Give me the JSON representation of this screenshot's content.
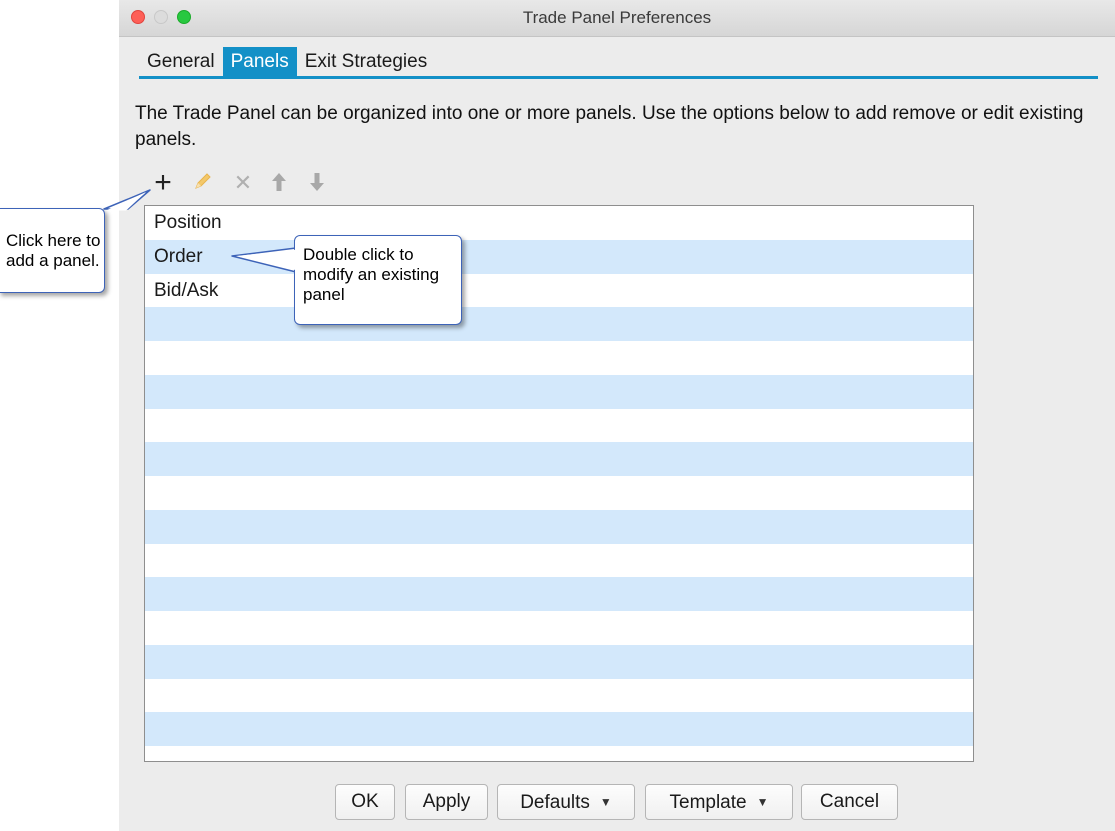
{
  "window": {
    "title": "Trade Panel Preferences"
  },
  "tabs": [
    {
      "label": "General",
      "active": false
    },
    {
      "label": "Panels",
      "active": true
    },
    {
      "label": "Exit Strategies",
      "active": false
    }
  ],
  "description": "The Trade Panel can be organized into one or more panels.  Use the options below to add remove or edit existing panels.",
  "toolbar": {
    "add_icon": "plus-icon",
    "edit_icon": "pencil-icon",
    "delete_icon": "x-icon",
    "move_up_icon": "arrow-up-icon",
    "move_down_icon": "arrow-down-icon"
  },
  "panels_list": {
    "items": [
      "Position",
      "Order",
      "Bid/Ask"
    ]
  },
  "buttons": {
    "ok": "OK",
    "apply": "Apply",
    "defaults": "Defaults",
    "template": "Template",
    "cancel": "Cancel"
  },
  "callouts": {
    "add_panel": "Click here to add a panel.",
    "modify_panel": "Double click to modify an existing panel"
  },
  "colors": {
    "accent": "#1390c7",
    "row_alt": "#d3e8fb",
    "callout_border": "#3d63b8"
  }
}
